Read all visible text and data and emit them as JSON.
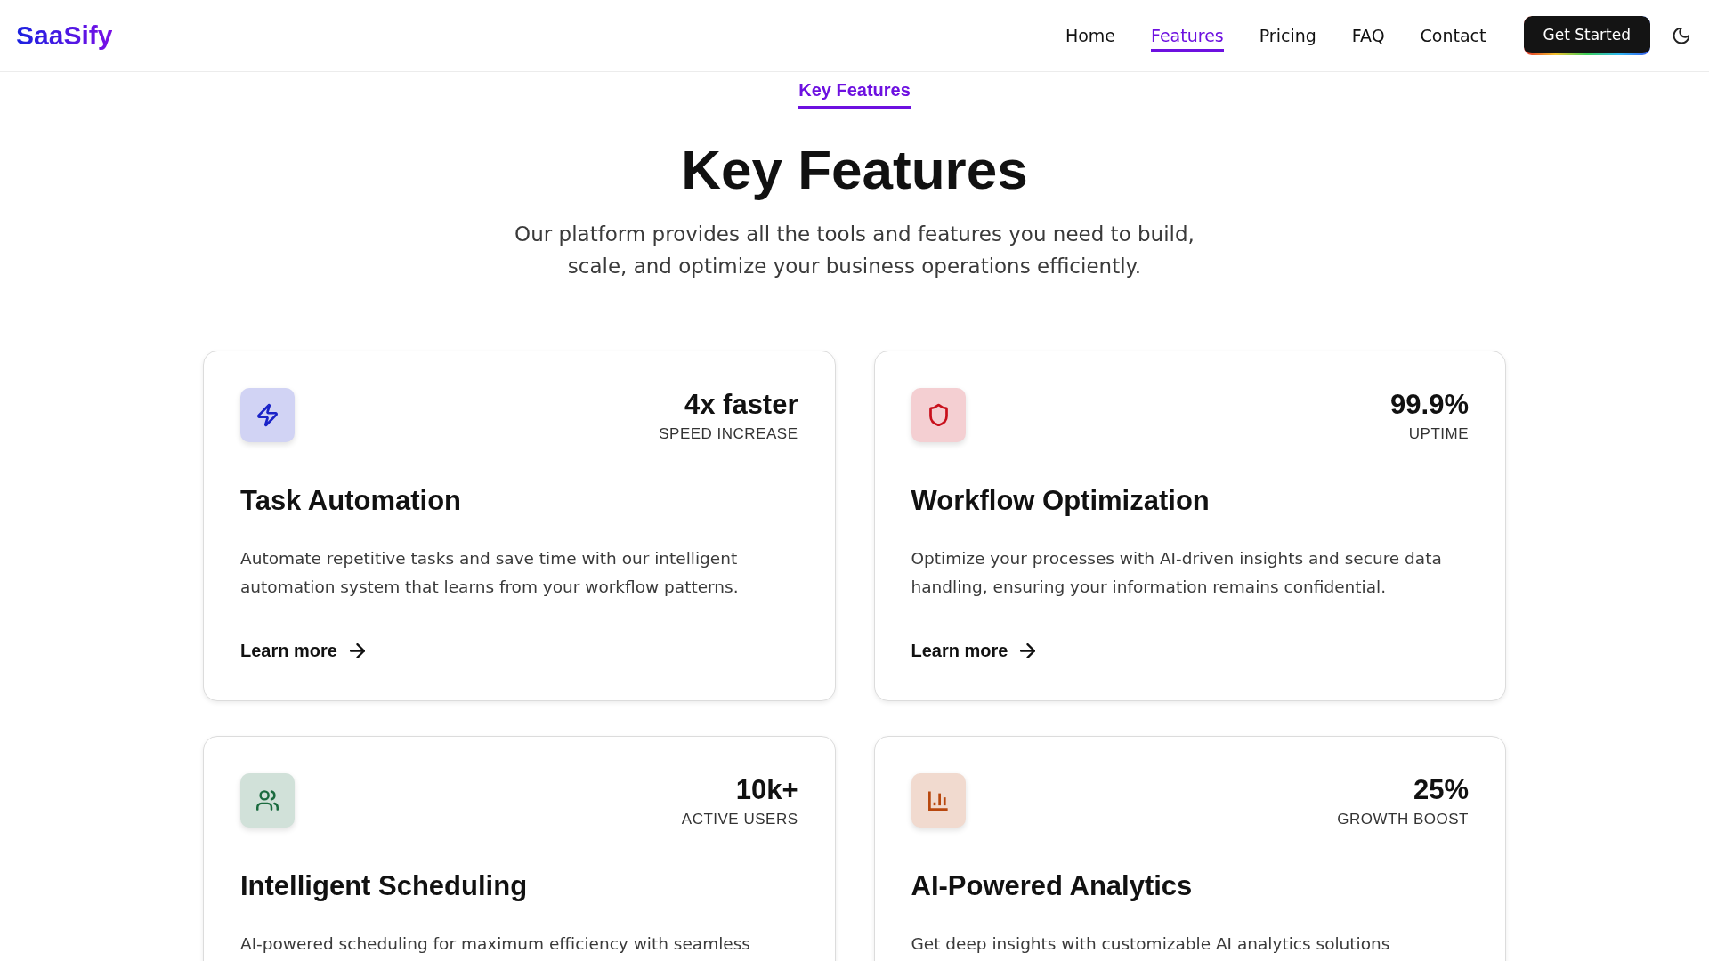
{
  "header": {
    "logo": "SaaSify",
    "nav": [
      {
        "label": "Home",
        "selected": false
      },
      {
        "label": "Features",
        "selected": true
      },
      {
        "label": "Pricing",
        "selected": false
      },
      {
        "label": "FAQ",
        "selected": false
      },
      {
        "label": "Contact",
        "selected": false
      }
    ],
    "cta": "Get Started"
  },
  "section": {
    "eyebrow": "Key Features",
    "title": "Key Features",
    "subtitle": "Our platform provides all the tools and features you need to build, scale, and optimize your business operations efficiently."
  },
  "features": [
    {
      "color": "#1a23c8",
      "stat": "4x faster",
      "stat_label": "SPEED INCREASE",
      "title": "Task Automation",
      "description": "Automate repetitive tasks and save time with our intelligent automation system that learns from your workflow patterns.",
      "link": "Learn more"
    },
    {
      "color": "#c8101c",
      "stat": "99.9%",
      "stat_label": "UPTIME",
      "title": "Workflow Optimization",
      "description": "Optimize your processes with AI-driven insights and secure data handling, ensuring your information remains confidential.",
      "link": "Learn more"
    },
    {
      "color": "#1b6b3f",
      "stat": "10k+",
      "stat_label": "ACTIVE USERS",
      "title": "Intelligent Scheduling",
      "description": "AI-powered scheduling for maximum efficiency with seamless"
    },
    {
      "color": "#b8470e",
      "stat": "25%",
      "stat_label": "GROWTH BOOST",
      "title": "AI-Powered Analytics",
      "description": "Get deep insights with customizable AI analytics solutions"
    }
  ]
}
